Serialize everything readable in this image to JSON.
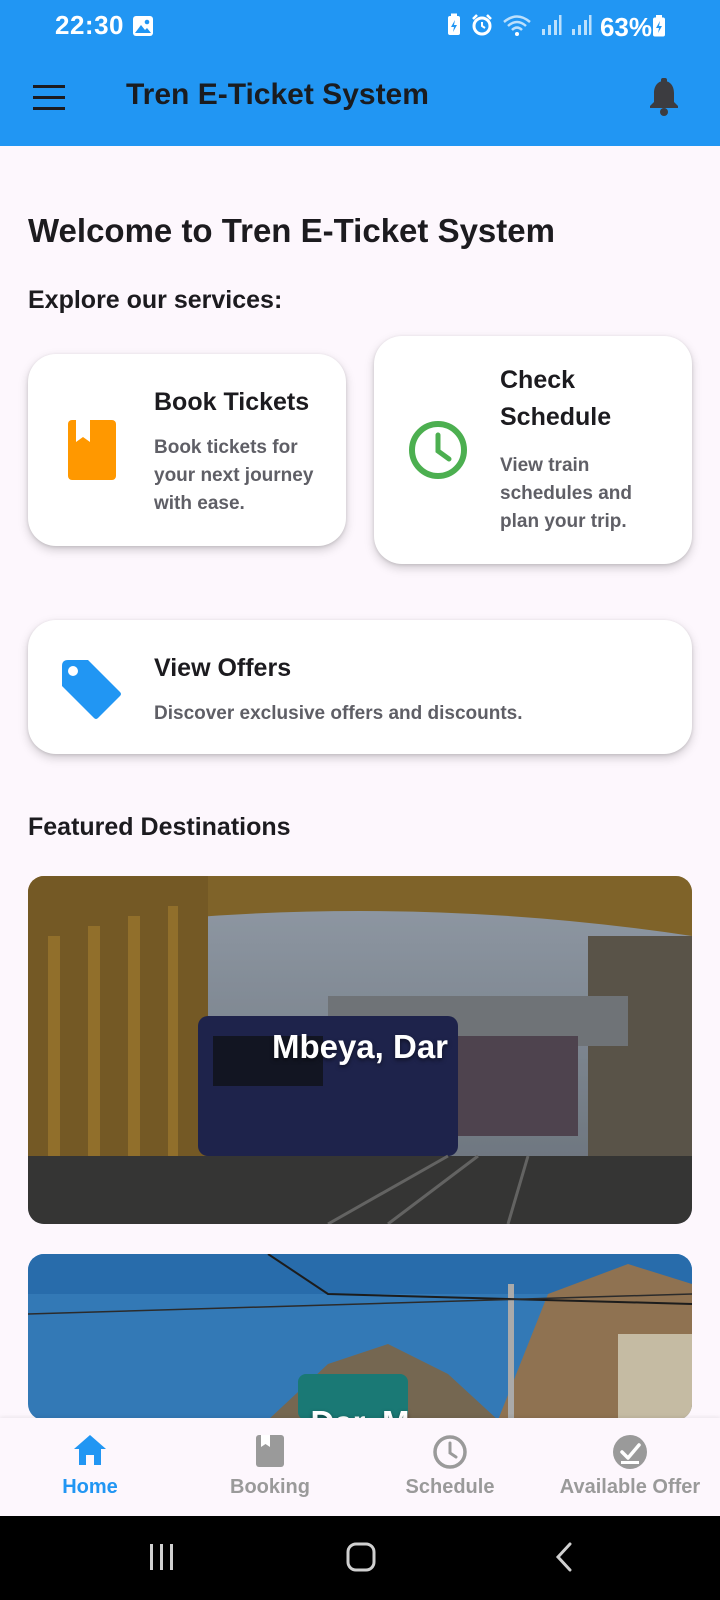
{
  "status_bar": {
    "time": "22:30",
    "battery": "63%",
    "icons": [
      "gallery-icon",
      "battery-saver-icon",
      "alarm-icon",
      "wifi-icon",
      "signal-icon",
      "signal-icon",
      "battery-icon"
    ]
  },
  "app_bar": {
    "title": "Tren E-Ticket System",
    "menu_icon": "hamburger-menu-icon",
    "notification_icon": "bell-icon"
  },
  "home": {
    "welcome": "Welcome to Tren E-Ticket System",
    "explore": "Explore our services:",
    "services": [
      {
        "title": "Book Tickets",
        "description": "Book tickets for your next journey with ease.",
        "icon": "book-icon",
        "icon_color": "#ff9800"
      },
      {
        "title": "Check Schedule",
        "description": "View train schedules and plan your trip.",
        "icon": "clock-icon",
        "icon_color": "#4caf50"
      },
      {
        "title": "View Offers",
        "description": "Discover exclusive offers and discounts.",
        "icon": "tag-icon",
        "icon_color": "#2196f3"
      }
    ],
    "featured_title": "Featured Destinations",
    "destinations": [
      {
        "name": "Mbeya, Dar"
      },
      {
        "name": "Dar, M"
      }
    ]
  },
  "bottom_nav": {
    "items": [
      {
        "label": "Home",
        "icon": "home-icon",
        "active": true
      },
      {
        "label": "Booking",
        "icon": "book-icon",
        "active": false
      },
      {
        "label": "Schedule",
        "icon": "clock-icon",
        "active": false
      },
      {
        "label": "Available Offer",
        "icon": "check-circle-icon",
        "active": false
      }
    ]
  },
  "colors": {
    "primary": "#2196f3",
    "background": "#fdf7fd",
    "book_orange": "#ff9800",
    "schedule_green": "#4caf50",
    "inactive_gray": "#9a9a9a"
  }
}
